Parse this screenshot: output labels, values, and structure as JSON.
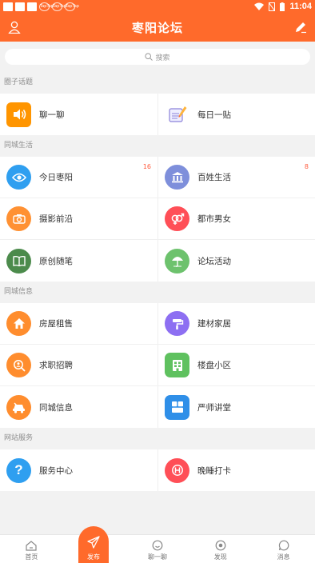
{
  "status": {
    "time": "11:04",
    "mini_icons": [
      "TapTap",
      "TapTap",
      "TapTap"
    ]
  },
  "header": {
    "title": "枣阳论坛"
  },
  "search": {
    "placeholder": "搜索"
  },
  "sections": [
    {
      "title": "圈子话题",
      "items": [
        {
          "label": "聊一聊",
          "icon": "speaker-icon",
          "color": "#ff9500",
          "badge": ""
        },
        {
          "label": "每日一贴",
          "icon": "note-icon",
          "color": "#ffffff",
          "badge": ""
        }
      ]
    },
    {
      "title": "同城生活",
      "items": [
        {
          "label": "今日枣阳",
          "icon": "eye-icon",
          "color": "#2f9ff0",
          "badge": "16"
        },
        {
          "label": "百姓生活",
          "icon": "bank-icon",
          "color": "#7e8fdb",
          "badge": "8"
        },
        {
          "label": "摄影前沿",
          "icon": "camera-icon",
          "color": "#ff9133",
          "badge": ""
        },
        {
          "label": "都市男女",
          "icon": "gender-icon",
          "color": "#ff4f57",
          "badge": ""
        },
        {
          "label": "原创随笔",
          "icon": "book-icon",
          "color": "#4c8b4c",
          "badge": ""
        },
        {
          "label": "论坛活动",
          "icon": "umbrella-icon",
          "color": "#6dc26d",
          "badge": ""
        }
      ]
    },
    {
      "title": "同城信息",
      "items": [
        {
          "label": "房屋租售",
          "icon": "house-icon",
          "color": "#ff8d2e",
          "badge": ""
        },
        {
          "label": "建材家居",
          "icon": "paint-roller-icon",
          "color": "#8d6ff2",
          "badge": ""
        },
        {
          "label": "求职招聘",
          "icon": "search-person-icon",
          "color": "#ff8d2e",
          "badge": ""
        },
        {
          "label": "楼盘小区",
          "icon": "building-icon",
          "color": "#5fc15f",
          "badge": ""
        },
        {
          "label": "同城信息",
          "icon": "car-icon",
          "color": "#ff8d2e",
          "badge": ""
        },
        {
          "label": "严师讲堂",
          "icon": "grid-icon",
          "color": "#2f8fe8",
          "badge": ""
        }
      ]
    },
    {
      "title": "网站服务",
      "items": [
        {
          "label": "服务中心",
          "icon": "question-icon",
          "color": "#2f9ff0",
          "badge": ""
        },
        {
          "label": "晚睡打卡",
          "icon": "moon-icon",
          "color": "#ff4f57",
          "badge": ""
        }
      ]
    }
  ],
  "tabbar": [
    {
      "label": "首页",
      "icon": "home-icon"
    },
    {
      "label": "发布",
      "icon": "send-icon"
    },
    {
      "label": "聊一聊",
      "icon": "chat-icon"
    },
    {
      "label": "发现",
      "icon": "discover-icon"
    },
    {
      "label": "消息",
      "icon": "message-icon"
    }
  ]
}
